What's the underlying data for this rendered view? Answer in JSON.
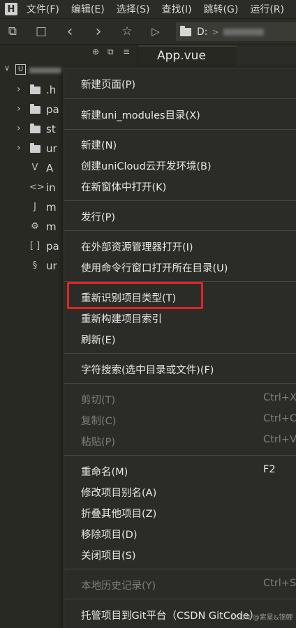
{
  "menubar": {
    "logo": "H",
    "items": [
      "文件(F)",
      "编辑(E)",
      "选择(S)",
      "查找(I)",
      "跳转(G)",
      "运行(R)"
    ]
  },
  "toolbar": {
    "icons": [
      "save-as-icon",
      "save-icon",
      "back-icon",
      "forward-icon",
      "star-icon",
      "play-icon"
    ],
    "path_drive": "D:",
    "path_sep": ">"
  },
  "sidebar": {
    "root_badge": "U",
    "items": [
      {
        "type": "folder",
        "label": ".h",
        "expandable": true
      },
      {
        "type": "folder",
        "label": "pa",
        "expandable": true
      },
      {
        "type": "folder",
        "label": "st",
        "expandable": true
      },
      {
        "type": "folder",
        "label": "ur",
        "expandable": true
      },
      {
        "type": "file",
        "icon": "V",
        "label": "A",
        "expandable": false
      },
      {
        "type": "file",
        "icon": "<>",
        "label": "in",
        "expandable": false
      },
      {
        "type": "file",
        "icon": "J",
        "label": "m",
        "expandable": false
      },
      {
        "type": "file",
        "icon": "⚙",
        "label": "m",
        "expandable": false
      },
      {
        "type": "file",
        "icon": "[ ]",
        "label": "pa",
        "expandable": false
      },
      {
        "type": "file",
        "icon": "§",
        "label": "ur",
        "expandable": false
      }
    ]
  },
  "editor": {
    "tab_label": "App.vue"
  },
  "context_menu": {
    "items": [
      {
        "label": "新建页面(P)",
        "shortcut": "",
        "disabled": false
      },
      {
        "label": "新建uni_modules目录(X)",
        "shortcut": "",
        "disabled": false
      },
      {
        "label": "新建(N)",
        "shortcut": "",
        "disabled": false
      },
      {
        "label": "创建uniCloud云开发环境(B)",
        "shortcut": "",
        "disabled": false
      },
      {
        "label": "在新窗体中打开(K)",
        "shortcut": "",
        "disabled": false
      },
      {
        "label": "发行(P)",
        "shortcut": "",
        "disabled": false
      },
      {
        "label": "在外部资源管理器打开(I)",
        "shortcut": "",
        "disabled": false
      },
      {
        "label": "使用命令行窗口打开所在目录(U)",
        "shortcut": "",
        "disabled": false
      },
      {
        "label": "重新识别项目类型(T)",
        "shortcut": "",
        "disabled": false
      },
      {
        "label": "重新构建项目索引",
        "shortcut": "",
        "disabled": false
      },
      {
        "label": "刷新(E)",
        "shortcut": "",
        "disabled": false
      },
      {
        "label": "字符搜索(选中目录或文件)(F)",
        "shortcut": "",
        "disabled": false
      },
      {
        "label": "剪切(T)",
        "shortcut": "Ctrl+X",
        "disabled": true
      },
      {
        "label": "复制(C)",
        "shortcut": "Ctrl+C",
        "disabled": true
      },
      {
        "label": "粘贴(P)",
        "shortcut": "Ctrl+V",
        "disabled": true
      },
      {
        "label": "重命名(M)",
        "shortcut": "F2",
        "disabled": false
      },
      {
        "label": "修改项目别名(A)",
        "shortcut": "",
        "disabled": false
      },
      {
        "label": "折叠其他项目(Z)",
        "shortcut": "",
        "disabled": false
      },
      {
        "label": "移除项目(D)",
        "shortcut": "",
        "disabled": false
      },
      {
        "label": "关闭项目(S)",
        "shortcut": "",
        "disabled": false
      },
      {
        "label": "本地历史记录(Y)",
        "shortcut": "Ctrl+Sl",
        "disabled": true
      },
      {
        "label": "托管项目到Git平台（CSDN GitCode）",
        "shortcut": "",
        "disabled": false
      }
    ],
    "highlight_color": "#e02424"
  },
  "watermark": "CSDN @紫星&锦鲤"
}
